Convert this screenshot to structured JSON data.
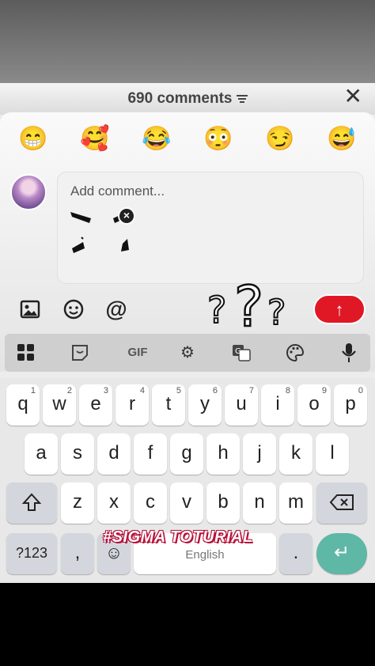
{
  "header": {
    "comment_count": "690 comments",
    "close_label": "✕"
  },
  "emojis": [
    "😁",
    "🥰",
    "😂",
    "😳",
    "😏",
    "😅"
  ],
  "composer": {
    "placeholder": "Add comment...",
    "send_label": "↑"
  },
  "tools": {
    "image_icon": "image-icon",
    "emoji_icon": "emoji-icon",
    "mention_label": "@"
  },
  "keyboard_toolbar": {
    "gif_label": "GIF"
  },
  "keyboard": {
    "row1": [
      {
        "key": "q",
        "hint": "1"
      },
      {
        "key": "w",
        "hint": "2"
      },
      {
        "key": "e",
        "hint": "3"
      },
      {
        "key": "r",
        "hint": "4"
      },
      {
        "key": "t",
        "hint": "5"
      },
      {
        "key": "y",
        "hint": "6"
      },
      {
        "key": "u",
        "hint": "7"
      },
      {
        "key": "i",
        "hint": "8"
      },
      {
        "key": "o",
        "hint": "9"
      },
      {
        "key": "p",
        "hint": "0"
      }
    ],
    "row2": [
      "a",
      "s",
      "d",
      "f",
      "g",
      "h",
      "j",
      "k",
      "l"
    ],
    "row3": [
      "z",
      "x",
      "c",
      "v",
      "b",
      "n",
      "m"
    ],
    "symbols_label": "?123",
    "comma_label": ",",
    "space_label": "English",
    "period_label": ".",
    "enter_label": "↵"
  },
  "watermark": "#SIGMA TOTURIAL"
}
